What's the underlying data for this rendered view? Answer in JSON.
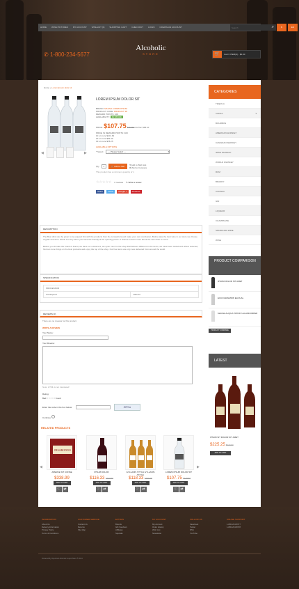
{
  "topnav": {
    "links": [
      "Home",
      "Wine Pictures",
      "My Account",
      "Wishlist (0)",
      "Shopping Cart",
      "Checkout",
      "Login",
      "Create an Account"
    ],
    "search_placeholder": "Search",
    "currency": "$",
    "language": "EN"
  },
  "header": {
    "phone": "1-800-234-5677",
    "logo_name": "Alcoholic",
    "logo_sub": "STORE",
    "cart_label": "Cart",
    "cart_text": "0 ITEM(S) - $0.00"
  },
  "breadcrumb": {
    "home": "Home",
    "current": "Lorem Ipsum dolor sit"
  },
  "product": {
    "title": "LOREM IPSUM DOLOR SIT",
    "brand_label": "BRAND:",
    "brand": "MAGNA LOREM IPSUM",
    "code_label": "PRODUCT CODE:",
    "code": "PRODUCT 18",
    "points_label": "REWARD POINTS:",
    "points": "100",
    "avail_label": "AVAILABILITY:",
    "stock": "IN STOCK",
    "price_label": "PRICE:",
    "price": "$107.75",
    "old_price": "$118.50",
    "ex_tax": "Ex Tax: $95.10",
    "points_price": "PRICE IN REWARD POINTS: 400",
    "discounts": [
      "10 or more $101.62",
      "20 or more $92.40",
      "30 or more $78.25"
    ],
    "options_title": "AVAILABLE OPTIONS",
    "select_label": "* Select:",
    "select_value": " --- Please Select --- ",
    "qty_label": "Qty",
    "qty": "1",
    "add_to_cart": "Add to Cart",
    "wishlist": "Add to Wish List",
    "compare": "Add to Compare",
    "min_qty": "This product has a minimum quantity of 1",
    "reviews": "0 reviews",
    "write_review": "Write a review",
    "share": [
      "Share",
      "Tweet",
      "Google +",
      "Pinterest"
    ]
  },
  "tabs": {
    "description_title": "DESCRIPTION",
    "description_p1": "The Best drink can be given to tie enjoyed first with the products from the competitors and make your own conclusion. Before take the best wine in our store we choose cognac and wine. Worth it to buy when you have the friendly at the opening prices. A chance to learn more about the new drink to come.",
    "description_p2": "Before you do take the brand of brand, we have our customers, we open much in the shop that delivers different on the items, we have been tested and others selected, find out more things on the best products and enjoy the top of the shop. Our fine items are only new delivered from around the world.",
    "spec_title": "SPECIFICATION",
    "spec_head": "PROCESSOR",
    "spec_key": "Clockspeed",
    "spec_val": "100mhz",
    "reviews_title": "REVIEWS (0)",
    "no_reviews": "There are no reviews for this product.",
    "write_title": "WRITE A REVIEW",
    "name_label": "Your Name:",
    "review_label": "Your Review:",
    "html_note": "Note: HTML is not translated!",
    "rating_label": "Rating:",
    "rating_scale": "Bad",
    "rating_scale_end": "Good",
    "captcha_label": "Enter the code in the box below:",
    "captcha_code": "8fF0a",
    "continue": "Continue"
  },
  "related": {
    "title": "RELATED PRODUCTS",
    "items": [
      {
        "name": "APERCE SIT CONSE",
        "price": "$338.99",
        "old": "",
        "btn": "ADD TO CART"
      },
      {
        "name": "IPSUM DOLOR",
        "price": "$116.33",
        "old": "$127.99",
        "btn": "ADD TO CART"
      },
      {
        "name": "GYLLANIS STYCA GYLLANIS STYCA",
        "price": "$118.33",
        "old": "$130.15",
        "btn": "ADD TO CART"
      },
      {
        "name": "LOREM IPSUM DOLOR SIT",
        "price": "$107.75",
        "old": "$118.50",
        "btn": "ADD TO CART"
      }
    ]
  },
  "sidebar": {
    "categories_title": "CATEGORIES",
    "categories": [
      "TEQUILA",
      "VODKA",
      "BOURBON",
      "AMERICAN WHISKEY",
      "CANADIAN WHISKEY",
      "IRISH WHISKEY",
      "WORLD WHISKEY",
      "RUM",
      "BRANDY",
      "COGNAC",
      "GIN",
      "LIQUEUR",
      "CHAMPAGNE",
      "SPARKLING WINE",
      "WINE"
    ],
    "compare_title": "PRODUCT COMPARISON",
    "compare_items": [
      "IPSUM DOLOR SIT AMET",
      "ECCO EMGMOW ELICUAL",
      "MAGNA ALIQUA TATION ULLAMCORPER"
    ],
    "compare_btn": "PRODUCT COMPARE",
    "latest_title": "LATEST",
    "latest_name": "IPSUM SIT DOLOR SIT AMET",
    "latest_price": "$225.25",
    "latest_old": "$270.50",
    "latest_btn": "ADD TO CART"
  },
  "footer": {
    "cols": [
      {
        "title": "INFORMATION",
        "links": [
          "About Us",
          "Delivery Information",
          "Privacy Policy",
          "Terms & Conditions"
        ]
      },
      {
        "title": "CUSTOMER SERVICE",
        "links": [
          "Contact Us",
          "Returns",
          "Site Map"
        ]
      },
      {
        "title": "EXTRAS",
        "links": [
          "Brands",
          "Gift Vouchers",
          "Affiliates",
          "Specials"
        ]
      },
      {
        "title": "MY ACCOUNT",
        "links": [
          "My Account",
          "Order History",
          "Wish List",
          "Newsletter"
        ]
      },
      {
        "title": "FOLLOW US",
        "links": [
          "Facebook",
          "Twitter",
          "RSS",
          "YouTube"
        ]
      },
      {
        "title": "ONLINE SUPPORT",
        "links": [
          "1-800-234-5677",
          "1-800-234-5678"
        ]
      }
    ],
    "copyright": "Powered By OpenCart Alcoholic Liquor Store © 2014"
  },
  "colors": {
    "accent": "#e8661f",
    "dark": "#4a4a4a",
    "wood": "#3a2a20"
  }
}
